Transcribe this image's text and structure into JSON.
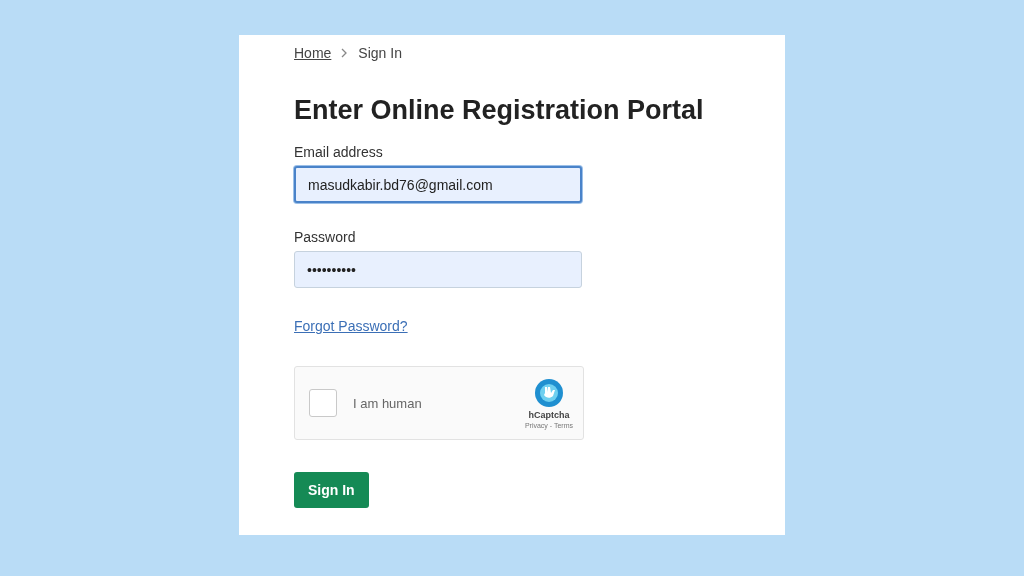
{
  "breadcrumb": [
    {
      "label": "Home",
      "link": true
    },
    {
      "label": "Sign In",
      "link": false
    }
  ],
  "title": "Enter Online Registration Portal",
  "fields": [
    {
      "label": "Email address",
      "value": "masudkabir.bd76@gmail.com",
      "focused": true
    },
    {
      "label": "Password",
      "value": "••••••••••",
      "focused": false
    }
  ],
  "forgot_link": "Forgot Password?",
  "captcha": {
    "label": "I am human",
    "checked": false,
    "brand": "hCaptcha",
    "links": "Privacy - Terms"
  },
  "submit": "Sign In"
}
